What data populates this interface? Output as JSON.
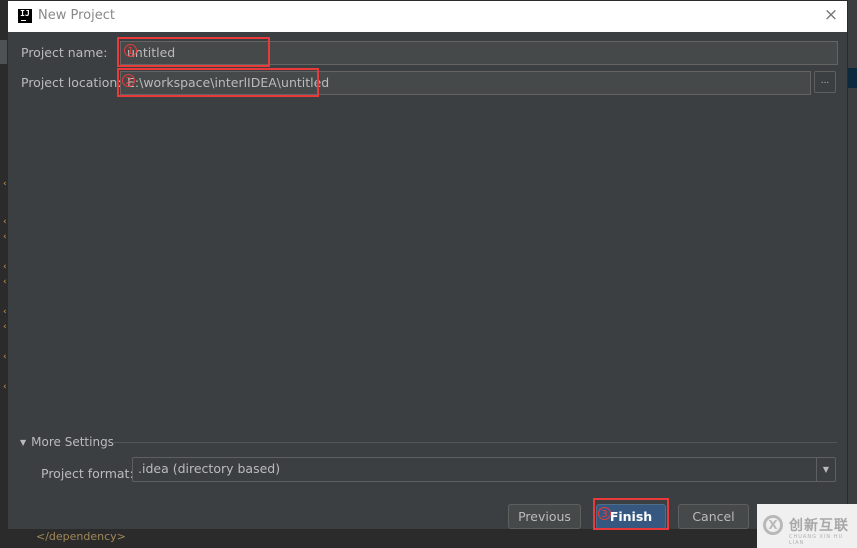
{
  "window": {
    "title": "New Project",
    "app_icon_label": "IJ",
    "close_symbol": "×"
  },
  "form": {
    "project_name_label": "Project name:",
    "project_name_value": "untitled",
    "project_location_label": "Project location:",
    "project_location_value": "E:\\workspace\\interlIDEA\\untitled",
    "browse_label": "...",
    "more_settings_label": "More Settings",
    "more_settings_expanded_symbol": "▼",
    "project_format_label": "Project format:",
    "project_format_value": ".idea (directory based)",
    "dropdown_symbol": "▼"
  },
  "buttons": {
    "previous": "Previous",
    "finish": "Finish",
    "cancel": "Cancel"
  },
  "annotations": {
    "step1": "1",
    "step2": "2",
    "step3": "3",
    "color": "#e83a3a"
  },
  "watermark": {
    "logo_glyph": "X",
    "text": "创新互联",
    "subtext": "CHUANG XIN HU LIAN"
  },
  "background": {
    "bottom_code": "</dependency>"
  },
  "colors": {
    "dialog_bg": "#3c3f41",
    "field_bg": "#45494a",
    "primary_button": "#365880",
    "text": "#bbbbbb"
  }
}
